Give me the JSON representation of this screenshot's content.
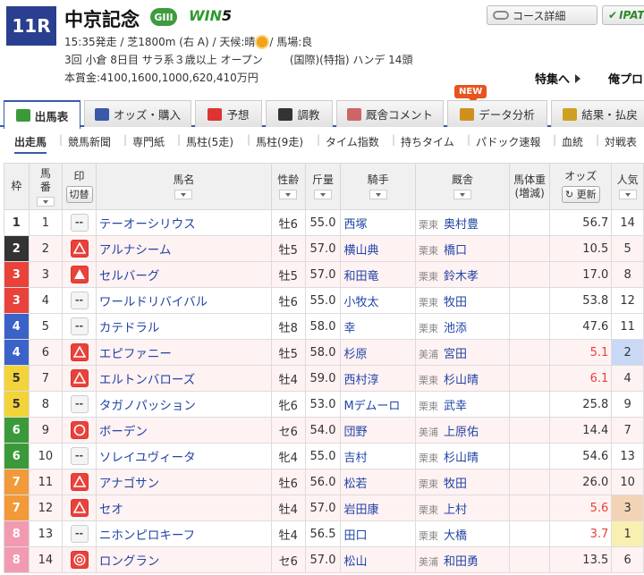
{
  "race": {
    "number": "11R",
    "name": "中京記念",
    "grade": "GIII",
    "win5": {
      "prefix": "WIN",
      "suffix": "5"
    },
    "info1_a": "15:35発走 / 芝1800m (右 A) / 天候:晴",
    "info1_b": "/ 馬場:良",
    "info2_a": "3回 小倉 8日目 サラ系３歳以上 オープン",
    "info2_b": "(国際)(特指) ハンデ 14頭",
    "prize": "本賞金:4100,1600,1000,620,410万円"
  },
  "top_buttons": {
    "course": "コース詳細",
    "ipat": "IPAT"
  },
  "feature": {
    "label": "特集へ",
    "label2": "俺プロ"
  },
  "tabs": [
    {
      "label": "出馬表",
      "icon": "table-icon",
      "color": "#3a9a3a"
    },
    {
      "label": "オッズ・購入",
      "icon": "money-icon",
      "color": "#3a5aa8"
    },
    {
      "label": "予想",
      "icon": "target-icon",
      "color": "#d33"
    },
    {
      "label": "調教",
      "icon": "stopwatch-icon",
      "color": "#333"
    },
    {
      "label": "厩舎コメント",
      "icon": "stable-icon",
      "color": "#c66"
    },
    {
      "label": "データ分析",
      "icon": "bar-chart-icon",
      "color": "#d09020"
    },
    {
      "label": "結果・払戻",
      "icon": "coins-icon",
      "color": "#d0a020"
    }
  ],
  "new_badge": "NEW",
  "subnav": [
    "出走馬",
    "競馬新聞",
    "専門紙",
    "馬柱(5走)",
    "馬柱(9走)",
    "タイム指数",
    "持ちタイム",
    "パドック速報",
    "血統",
    "対戦表"
  ],
  "table_headers": {
    "waku": "枠",
    "umaban_1": "馬",
    "umaban_2": "番",
    "mark": "印",
    "mark_btn": "切替",
    "horse": "馬名",
    "sex_age": "性齢",
    "kinryo_1": "斤",
    "kinryo_2": "量",
    "jockey": "騎手",
    "trainer": "厩舎",
    "weight_1": "馬体重",
    "weight_2": "(増減)",
    "odds": "オッズ",
    "odds_btn": "更新",
    "ninki_1": "人気"
  },
  "waku_colors": {
    "1": {
      "bg": "#ffffff",
      "fg": "#333333"
    },
    "2": {
      "bg": "#333333",
      "fg": "#ffffff"
    },
    "3": {
      "bg": "#e8423a",
      "fg": "#ffffff"
    },
    "4": {
      "bg": "#3a62c8",
      "fg": "#ffffff"
    },
    "5": {
      "bg": "#f2d43a",
      "fg": "#333333"
    },
    "6": {
      "bg": "#3a9a3a",
      "fg": "#ffffff"
    },
    "7": {
      "bg": "#f29a3a",
      "fg": "#ffffff"
    },
    "8": {
      "bg": "#f29ab2",
      "fg": "#ffffff"
    }
  },
  "entries": [
    {
      "waku": "1",
      "umaban": "1",
      "mark": "--",
      "mark_type": "none",
      "horse": "テーオーシリウス",
      "sex_age": "牡6",
      "kinryo": "55.0",
      "jockey": "西塚",
      "region": "栗東",
      "trainer": "奥村豊",
      "weight": "",
      "odds": "56.7",
      "hot": false,
      "ninki": "14",
      "pop_class": ""
    },
    {
      "waku": "2",
      "umaban": "2",
      "mark": "△",
      "mark_type": "triangle-outline",
      "horse": "アルナシーム",
      "sex_age": "牡5",
      "kinryo": "57.0",
      "jockey": "横山典",
      "region": "栗東",
      "trainer": "橋口",
      "weight": "",
      "odds": "10.5",
      "hot": false,
      "ninki": "5",
      "pop_class": ""
    },
    {
      "waku": "3",
      "umaban": "3",
      "mark": "▲",
      "mark_type": "triangle-filled",
      "horse": "セルバーグ",
      "sex_age": "牡5",
      "kinryo": "57.0",
      "jockey": "和田竜",
      "region": "栗東",
      "trainer": "鈴木孝",
      "weight": "",
      "odds": "17.0",
      "hot": false,
      "ninki": "8",
      "pop_class": ""
    },
    {
      "waku": "3",
      "umaban": "4",
      "mark": "--",
      "mark_type": "none",
      "horse": "ワールドリバイバル",
      "sex_age": "牡6",
      "kinryo": "55.0",
      "jockey": "小牧太",
      "region": "栗東",
      "trainer": "牧田",
      "weight": "",
      "odds": "53.8",
      "hot": false,
      "ninki": "12",
      "pop_class": ""
    },
    {
      "waku": "4",
      "umaban": "5",
      "mark": "--",
      "mark_type": "none",
      "horse": "カテドラル",
      "sex_age": "牡8",
      "kinryo": "58.0",
      "jockey": "幸",
      "region": "栗東",
      "trainer": "池添",
      "weight": "",
      "odds": "47.6",
      "hot": false,
      "ninki": "11",
      "pop_class": ""
    },
    {
      "waku": "4",
      "umaban": "6",
      "mark": "△",
      "mark_type": "triangle-outline",
      "horse": "エピファニー",
      "sex_age": "牡5",
      "kinryo": "58.0",
      "jockey": "杉原",
      "region": "美浦",
      "trainer": "宮田",
      "weight": "",
      "odds": "5.1",
      "hot": true,
      "ninki": "2",
      "pop_class": "p2"
    },
    {
      "waku": "5",
      "umaban": "7",
      "mark": "△",
      "mark_type": "triangle-outline",
      "horse": "エルトンバローズ",
      "sex_age": "牡4",
      "kinryo": "59.0",
      "jockey": "西村淳",
      "region": "栗東",
      "trainer": "杉山晴",
      "weight": "",
      "odds": "6.1",
      "hot": true,
      "ninki": "4",
      "pop_class": ""
    },
    {
      "waku": "5",
      "umaban": "8",
      "mark": "--",
      "mark_type": "none",
      "horse": "タガノパッション",
      "sex_age": "牝6",
      "kinryo": "53.0",
      "jockey": "Mデムーロ",
      "region": "栗東",
      "trainer": "武幸",
      "weight": "",
      "odds": "25.8",
      "hot": false,
      "ninki": "9",
      "pop_class": ""
    },
    {
      "waku": "6",
      "umaban": "9",
      "mark": "○",
      "mark_type": "circle",
      "horse": "ボーデン",
      "sex_age": "セ6",
      "kinryo": "54.0",
      "jockey": "団野",
      "region": "美浦",
      "trainer": "上原佑",
      "weight": "",
      "odds": "14.4",
      "hot": false,
      "ninki": "7",
      "pop_class": ""
    },
    {
      "waku": "6",
      "umaban": "10",
      "mark": "--",
      "mark_type": "none",
      "horse": "ソレイユヴィータ",
      "sex_age": "牝4",
      "kinryo": "55.0",
      "jockey": "吉村",
      "region": "栗東",
      "trainer": "杉山晴",
      "weight": "",
      "odds": "54.6",
      "hot": false,
      "ninki": "13",
      "pop_class": ""
    },
    {
      "waku": "7",
      "umaban": "11",
      "mark": "△",
      "mark_type": "triangle-outline",
      "horse": "アナゴサン",
      "sex_age": "牡6",
      "kinryo": "56.0",
      "jockey": "松若",
      "region": "栗東",
      "trainer": "牧田",
      "weight": "",
      "odds": "26.0",
      "hot": false,
      "ninki": "10",
      "pop_class": ""
    },
    {
      "waku": "7",
      "umaban": "12",
      "mark": "△",
      "mark_type": "triangle-outline",
      "horse": "セオ",
      "sex_age": "牡4",
      "kinryo": "57.0",
      "jockey": "岩田康",
      "region": "栗東",
      "trainer": "上村",
      "weight": "",
      "odds": "5.6",
      "hot": true,
      "ninki": "3",
      "pop_class": "p3"
    },
    {
      "waku": "8",
      "umaban": "13",
      "mark": "--",
      "mark_type": "none",
      "horse": "ニホンピロキーフ",
      "sex_age": "牡4",
      "kinryo": "56.5",
      "jockey": "田口",
      "region": "栗東",
      "trainer": "大橋",
      "weight": "",
      "odds": "3.7",
      "hot": true,
      "ninki": "1",
      "pop_class": "p1"
    },
    {
      "waku": "8",
      "umaban": "14",
      "mark": "◎",
      "mark_type": "double-circle",
      "horse": "ロングラン",
      "sex_age": "セ6",
      "kinryo": "57.0",
      "jockey": "松山",
      "region": "美浦",
      "trainer": "和田勇",
      "weight": "",
      "odds": "13.5",
      "hot": false,
      "ninki": "6",
      "pop_class": ""
    }
  ]
}
